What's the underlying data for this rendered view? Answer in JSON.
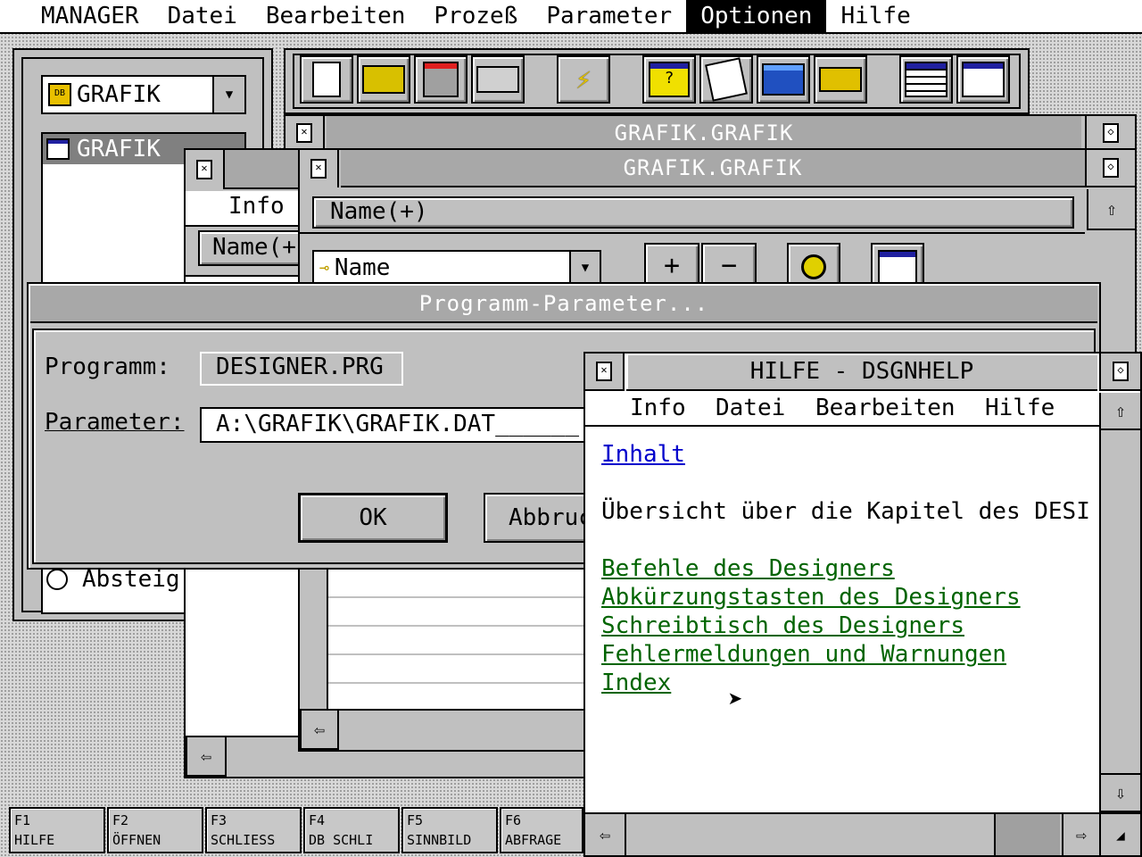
{
  "menubar": {
    "items": [
      "MANAGER",
      "Datei",
      "Bearbeiten",
      "Prozeß",
      "Parameter",
      "Optionen",
      "Hilfe"
    ],
    "selected": "Optionen"
  },
  "manager": {
    "db_select": "GRAFIK",
    "table_item": "GRAFIK",
    "radio_label": "Absteig"
  },
  "toolbar": {
    "icons": [
      "new-document-icon",
      "open-folder-icon",
      "save-disk-icon",
      "print-icon",
      "lightning-icon",
      "query-table-icon",
      "report-icon",
      "calculator-icon",
      "batch-icon",
      "table-icon",
      "form-icon"
    ]
  },
  "win_back": {
    "title": "GRAFIK.GRAFIK"
  },
  "win_mid": {
    "title": "GRAFIK.GRAFIK",
    "sort_field": "Name(+)",
    "index_select": "Name",
    "plus": "+",
    "minus": "−"
  },
  "win_left": {
    "menu_info": "Info",
    "field": "Name(+"
  },
  "dialog": {
    "title": "Programm-Parameter...",
    "programm_label": "Programm:",
    "programm_value": "DESIGNER.PRG",
    "parameter_label": "Parameter:",
    "parameter_value": "A:\\GRAFIK\\GRAFIK.DAT______",
    "ok": "OK",
    "cancel": "Abbruch"
  },
  "help": {
    "title": "HILFE - DSGNHELP",
    "menu": [
      "Info",
      "Datei",
      "Bearbeiten",
      "Hilfe"
    ],
    "heading_link": "Inhalt",
    "intro": "Übersicht über die Kapitel des DESI",
    "links": [
      "Befehle des Designers",
      "Abkürzungstasten des Designers",
      "Schreibtisch des Designers",
      "Fehlermeldungen und Warnungen",
      "Index"
    ]
  },
  "fkeys": [
    {
      "key": "F1",
      "label": "HILFE"
    },
    {
      "key": "F2",
      "label": "ÖFFNEN"
    },
    {
      "key": "F3",
      "label": "SCHLIESS"
    },
    {
      "key": "F4",
      "label": "DB SCHLI"
    },
    {
      "key": "F5",
      "label": "SINNBILD"
    },
    {
      "key": "F6",
      "label": "ABFRAGE"
    }
  ]
}
